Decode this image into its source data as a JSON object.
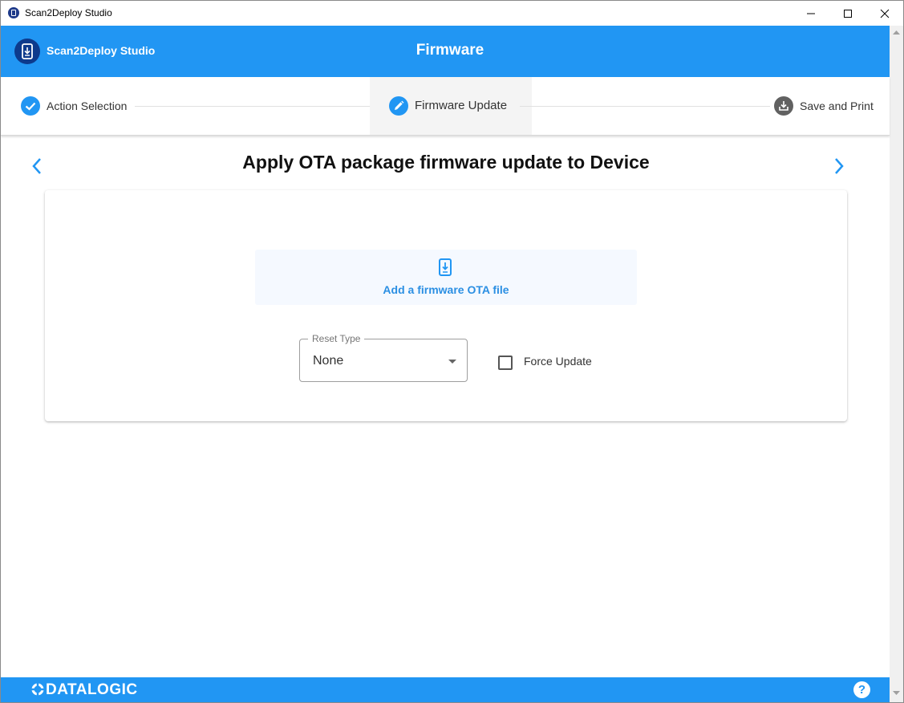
{
  "window": {
    "title": "Scan2Deploy Studio",
    "controls": [
      "minimize",
      "maximize",
      "close"
    ]
  },
  "header": {
    "brand_name": "Scan2Deploy Studio",
    "brand_icon": "device-download-icon",
    "page_title": "Firmware",
    "color": "#2196f3"
  },
  "stepper": {
    "steps": [
      {
        "label": "Action Selection",
        "state": "completed",
        "icon": "check-icon"
      },
      {
        "label": "Firmware Update",
        "state": "active",
        "icon": "pencil-icon"
      },
      {
        "label": "Save and Print",
        "state": "pending",
        "icon": "download-tray-icon"
      }
    ]
  },
  "content": {
    "title": "Apply OTA package firmware update to Device",
    "prev_icon": "chevron-left-icon",
    "next_icon": "chevron-right-icon",
    "dropzone": {
      "icon": "device-download-icon",
      "label": "Add a firmware OTA file"
    },
    "reset_type": {
      "label": "Reset Type",
      "value": "None"
    },
    "force_update": {
      "label": "Force Update",
      "checked": false
    }
  },
  "footer": {
    "logo": "DATALOGIC",
    "help_icon": "?"
  },
  "colors": {
    "accent": "#2196f3",
    "brand_dark": "#0d3a8c",
    "pending_step": "#616161"
  }
}
